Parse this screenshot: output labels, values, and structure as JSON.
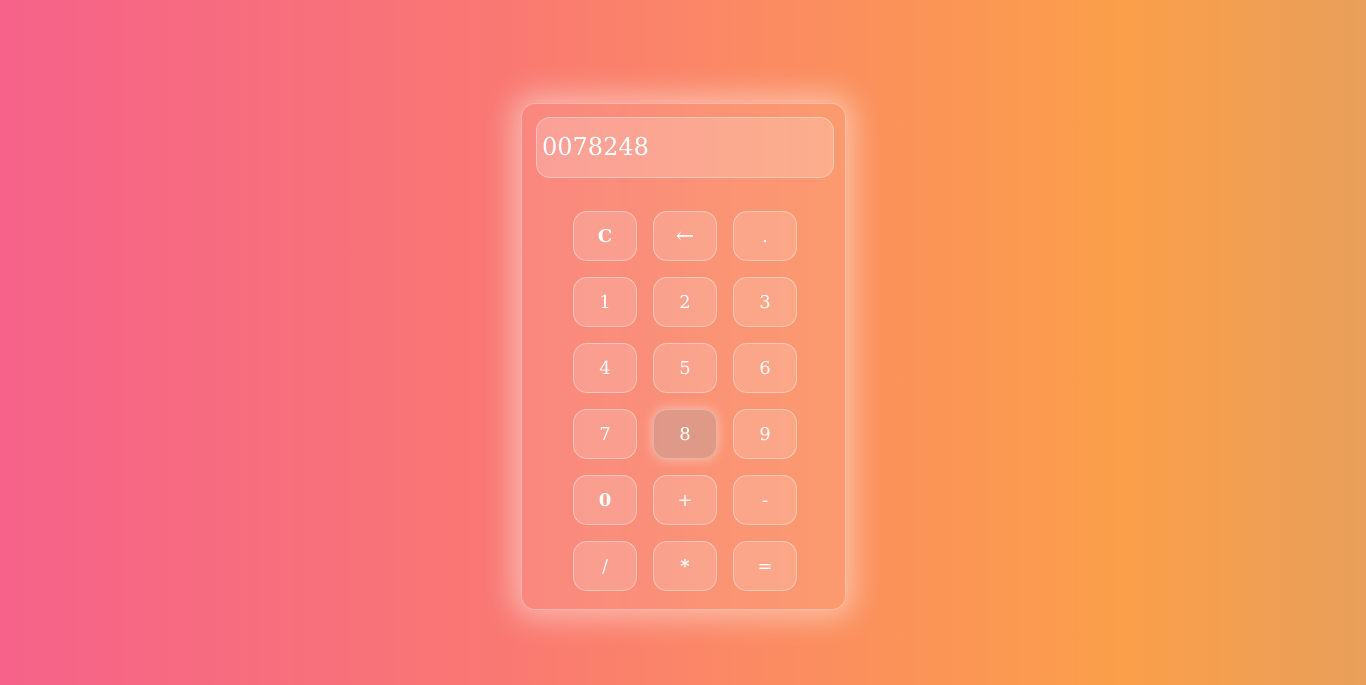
{
  "display": {
    "value": "0078248"
  },
  "keys": [
    {
      "label": "C",
      "name": "clear-button"
    },
    {
      "label": "←",
      "name": "backspace-button"
    },
    {
      "label": ".",
      "name": "decimal-button"
    },
    {
      "label": "1",
      "name": "digit-1-button"
    },
    {
      "label": "2",
      "name": "digit-2-button"
    },
    {
      "label": "3",
      "name": "digit-3-button"
    },
    {
      "label": "4",
      "name": "digit-4-button"
    },
    {
      "label": "5",
      "name": "digit-5-button"
    },
    {
      "label": "6",
      "name": "digit-6-button"
    },
    {
      "label": "7",
      "name": "digit-7-button"
    },
    {
      "label": "8",
      "name": "digit-8-button"
    },
    {
      "label": "9",
      "name": "digit-9-button"
    },
    {
      "label": "0",
      "name": "digit-0-button"
    },
    {
      "label": "+",
      "name": "add-button"
    },
    {
      "label": "-",
      "name": "subtract-button"
    },
    {
      "label": "/",
      "name": "divide-button"
    },
    {
      "label": "*",
      "name": "multiply-button"
    },
    {
      "label": "=",
      "name": "equals-button"
    }
  ],
  "pressed_key": "8"
}
